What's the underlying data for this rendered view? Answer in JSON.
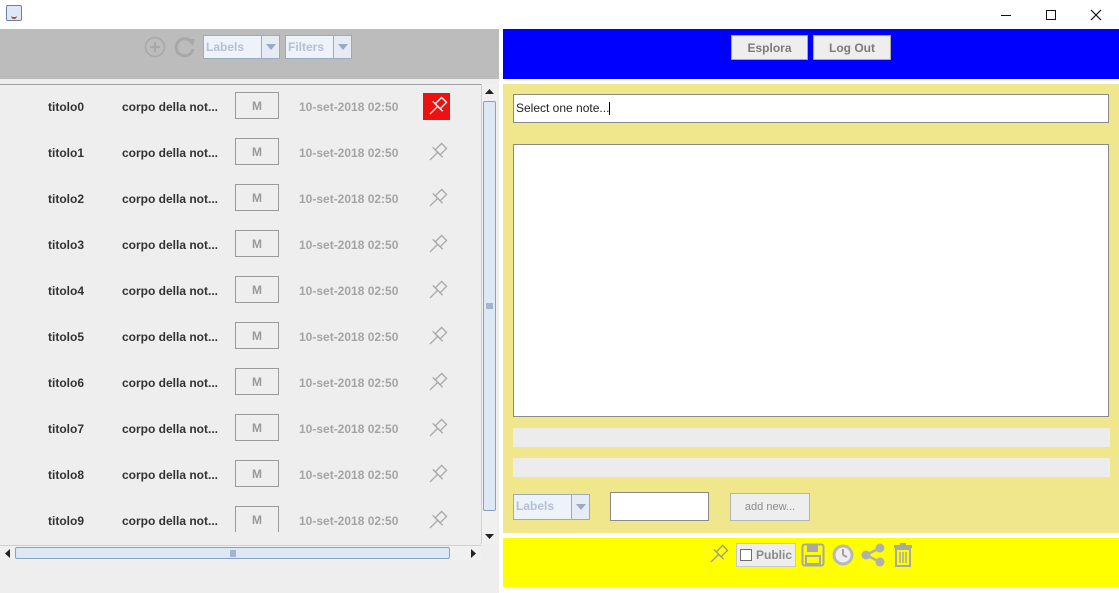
{
  "window": {
    "title": ""
  },
  "left_toolbar": {
    "labels_combo": "Labels",
    "filters_combo": "Filters",
    "icons": [
      "add-icon",
      "refresh-icon"
    ]
  },
  "notes": [
    {
      "title": "titolo0",
      "body": "corpo della not...",
      "m": "M",
      "date": "10-set-2018  02:50",
      "pinned": true
    },
    {
      "title": "titolo1",
      "body": "corpo della not...",
      "m": "M",
      "date": "10-set-2018  02:50",
      "pinned": false
    },
    {
      "title": "titolo2",
      "body": "corpo della not...",
      "m": "M",
      "date": "10-set-2018  02:50",
      "pinned": false
    },
    {
      "title": "titolo3",
      "body": "corpo della not...",
      "m": "M",
      "date": "10-set-2018  02:50",
      "pinned": false
    },
    {
      "title": "titolo4",
      "body": "corpo della not...",
      "m": "M",
      "date": "10-set-2018  02:50",
      "pinned": false
    },
    {
      "title": "titolo5",
      "body": "corpo della not...",
      "m": "M",
      "date": "10-set-2018  02:50",
      "pinned": false
    },
    {
      "title": "titolo6",
      "body": "corpo della not...",
      "m": "M",
      "date": "10-set-2018  02:50",
      "pinned": false
    },
    {
      "title": "titolo7",
      "body": "corpo della not...",
      "m": "M",
      "date": "10-set-2018  02:50",
      "pinned": false
    },
    {
      "title": "titolo8",
      "body": "corpo della not...",
      "m": "M",
      "date": "10-set-2018  02:50",
      "pinned": false
    },
    {
      "title": "titolo9",
      "body": "corpo della not...",
      "m": "M",
      "date": "10-set-2018  02:50",
      "pinned": false
    }
  ],
  "right_header": {
    "explore_label": "Esplora",
    "logout_label": "Log Out"
  },
  "editor": {
    "title_value": "Select one note...",
    "body_value": "",
    "labels_combo": "Labels",
    "new_label_value": "",
    "add_new_label": "add new..."
  },
  "bottom_bar": {
    "public_label": "Public",
    "public_checked": false,
    "icons": [
      "pin-icon",
      "save-icon",
      "clock-icon",
      "share-icon",
      "trash-icon"
    ]
  },
  "colors": {
    "header_blue": "#0000ff",
    "editor_bg": "#f0e68c",
    "bottom_yellow": "#ffff00",
    "pinned_red": "#ee1111",
    "toolbar_gray": "#bcbcbc"
  }
}
